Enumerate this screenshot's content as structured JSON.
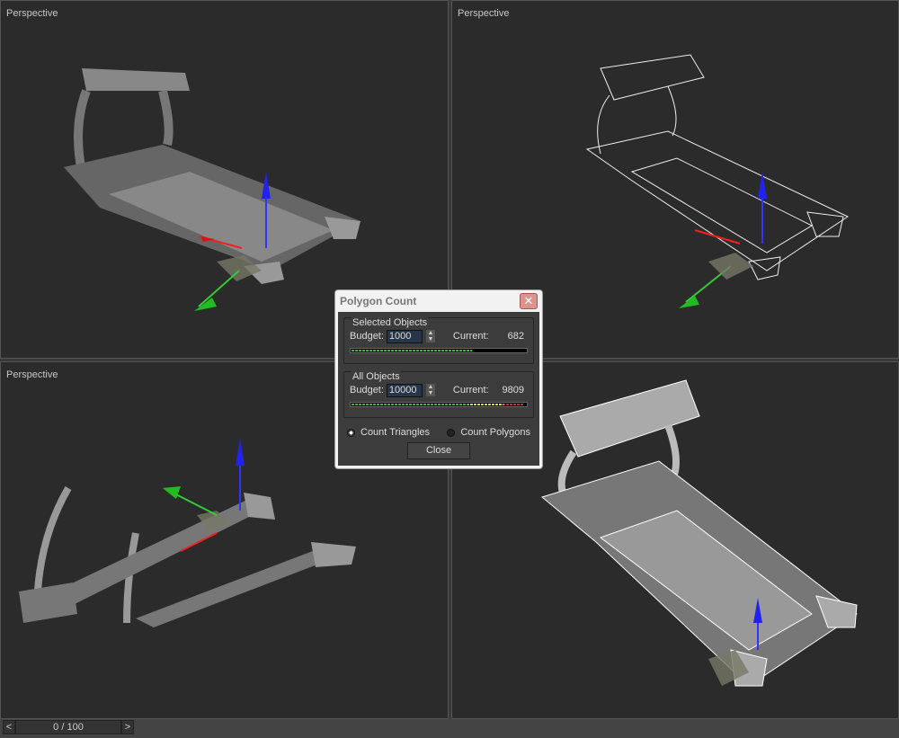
{
  "viewports": [
    {
      "label": "Perspective"
    },
    {
      "label": "Perspective"
    },
    {
      "label": "Perspective"
    },
    {
      "label": ""
    }
  ],
  "dialog": {
    "title": "Polygon Count",
    "close_x": "✕",
    "selected": {
      "title": "Selected Objects",
      "budget_label": "Budget:",
      "budget": "1000",
      "current_label": "Current:",
      "current": "682",
      "fraction": 0.682
    },
    "all": {
      "title": "All Objects",
      "budget_label": "Budget:",
      "budget": "10000",
      "current_label": "Current:",
      "current": "9809",
      "fraction": 0.9809
    },
    "count_triangles": "Count Triangles",
    "count_polygons": "Count Polygons",
    "selected_mode": "triangles",
    "close_label": "Close"
  },
  "timeline": {
    "prev": "<",
    "frame": "0 / 100",
    "next": ">"
  }
}
